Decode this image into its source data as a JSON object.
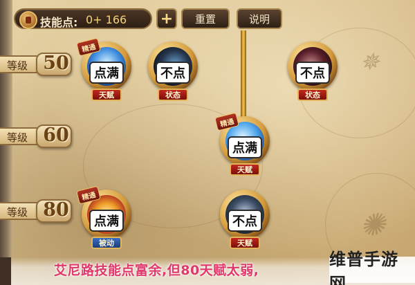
{
  "top_bar": {
    "skill_points_label": "技能点:",
    "skill_points_value": "0+ 166",
    "plus_label": "+",
    "reset_label": "重置",
    "help_label": "说明"
  },
  "levels": [
    {
      "prefix": "等级",
      "value": "50"
    },
    {
      "prefix": "等级",
      "value": "60"
    },
    {
      "prefix": "等级",
      "value": "80"
    }
  ],
  "skills": [
    {
      "id": "l50-a",
      "state": "点满",
      "tag": "天赋",
      "tag_color": "red",
      "mastery": "精通",
      "icon": "water-slash-icon"
    },
    {
      "id": "l50-b",
      "state": "不点",
      "tag": "状态",
      "tag_color": "red",
      "mastery": "",
      "icon": "dark-silhouette-icon"
    },
    {
      "id": "l50-c",
      "state": "不点",
      "tag": "状态",
      "tag_color": "red",
      "mastery": "",
      "icon": "demon-face-icon"
    },
    {
      "id": "l60-a",
      "state": "点满",
      "tag": "天赋",
      "tag_color": "red",
      "mastery": "精通",
      "icon": "water-wave-icon"
    },
    {
      "id": "l80-a",
      "state": "点满",
      "tag": "被动",
      "tag_color": "blue",
      "mastery": "精通",
      "icon": "flame-burst-icon"
    },
    {
      "id": "l80-b",
      "state": "不点",
      "tag": "天赋",
      "tag_color": "red",
      "mastery": "",
      "icon": "shadow-figure-icon"
    }
  ],
  "caption": "艾尼路技能点富余,但80天赋太弱,",
  "watermark": "维普手游网",
  "colors": {
    "caption": "#e0386b",
    "tag_red": "#c0281f",
    "tag_blue": "#3a6fc2",
    "connector_gold": "#f3c84a"
  }
}
